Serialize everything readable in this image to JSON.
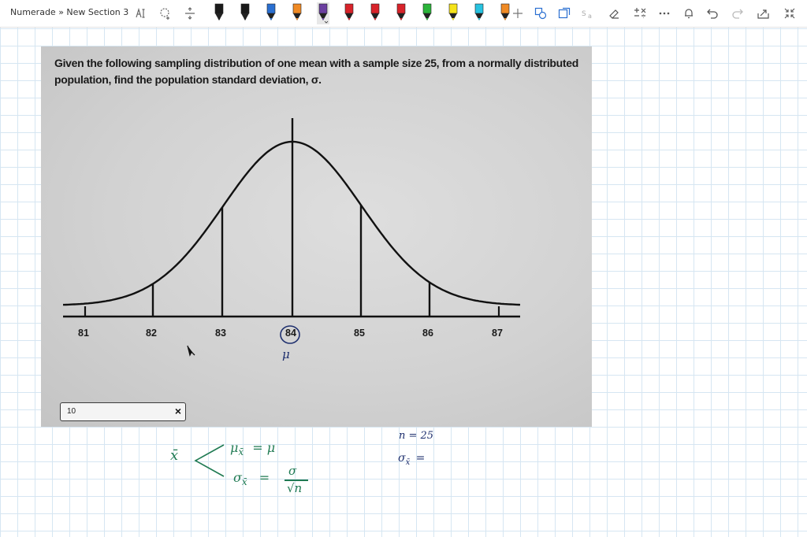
{
  "breadcrumb": "Numerade » New Section 3",
  "toolbar": {
    "tools": [
      "text-select-icon",
      "lasso-icon",
      "insert-space-icon"
    ],
    "pens": [
      {
        "name": "pen-black",
        "color": "#1a1a1a"
      },
      {
        "name": "pen-black-2",
        "color": "#1a1a1a"
      },
      {
        "name": "pen-blue",
        "color": "#2a6fd1"
      },
      {
        "name": "pen-orange",
        "color": "#f08a24"
      },
      {
        "name": "pen-purple",
        "color": "#6b3fa0"
      },
      {
        "name": "pen-red",
        "color": "#d8232a"
      },
      {
        "name": "pen-red-2",
        "color": "#d8232a"
      },
      {
        "name": "pen-red-3",
        "color": "#d8232a"
      },
      {
        "name": "pen-green",
        "color": "#2bb43a"
      },
      {
        "name": "pen-yellow",
        "color": "#f5e31a"
      },
      {
        "name": "pen-cyan",
        "color": "#27c3e0"
      },
      {
        "name": "pen-orange-2",
        "color": "#f08a24"
      }
    ],
    "selected_pen_index": 4,
    "right_tools": [
      "add-pen-icon",
      "shapes-icon",
      "ink-to-shape-icon",
      "ink-to-text-icon",
      "eraser-icon",
      "math-icon",
      "more-icon",
      "replay-icon",
      "undo-icon",
      "redo-icon",
      "share-icon",
      "fullscreen-icon"
    ]
  },
  "question": {
    "text": "Given the following sampling distribution of one mean with a sample size 25, from a normally distributed population, find the population standard deviation, σ."
  },
  "chart": {
    "ticks": [
      "81",
      "82",
      "83",
      "84",
      "85",
      "86",
      "87"
    ],
    "mean_label": "84"
  },
  "answer": {
    "value": "10",
    "clear": "×"
  },
  "notes": {
    "mu_under": "μ",
    "xbar": "x̄",
    "mu_line_lhs": "μ",
    "mu_line_sub": "x̄",
    "mu_line_eq": "= μ",
    "sigma_line_lhs": "σ",
    "sigma_line_sub": "x̄",
    "sigma_line_eq": "=",
    "frac_num": "σ",
    "frac_den": "√n",
    "n_eq": "n = 25",
    "sigma_xbar": "σ",
    "sigma_xbar_sub": "x̄",
    "sigma_xbar_eq": "="
  }
}
